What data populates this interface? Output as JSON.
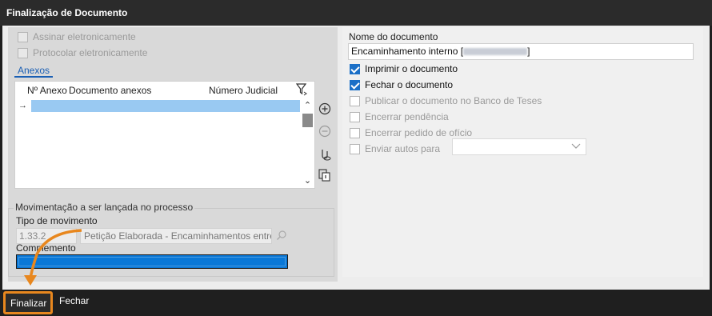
{
  "window": {
    "title": "Finalização de Documento"
  },
  "left": {
    "assinar_label": "Assinar eletronicamente",
    "protocolar_label": "Protocolar eletronicamente",
    "anexos_tab": "Anexos",
    "grid": {
      "col_numero": "Nº Anexo",
      "col_documento": "Documento anexos",
      "col_judicial": "Número Judicial",
      "row_marker": "→"
    },
    "movimentacao": {
      "legend": "Movimentação a ser lançada no processo",
      "tipo_label": "Tipo de movimento",
      "tipo_code": "1.33.2",
      "tipo_desc": "Petição Elaborada - Encaminhamentos entre c",
      "complemento_label": "Complemento",
      "complemento_value": ""
    },
    "icons": [
      "add-circle-icon",
      "remove-circle-icon",
      "attach-icon",
      "copy-attachment-icon",
      "filter-icon"
    ]
  },
  "right": {
    "nome_label": "Nome do documento",
    "nome_value": "Encaminhamento interno [",
    "nome_suffix": "]",
    "options": [
      {
        "label": "Imprimir o documento",
        "checked": true,
        "enabled": true
      },
      {
        "label": "Fechar o documento",
        "checked": true,
        "enabled": true
      },
      {
        "label": "Publicar o documento no Banco de Teses",
        "checked": false,
        "enabled": false
      },
      {
        "label": "Encerrar pendência",
        "checked": false,
        "enabled": false
      },
      {
        "label": "Encerrar pedido de ofício",
        "checked": false,
        "enabled": false
      },
      {
        "label": "Enviar autos para",
        "checked": false,
        "enabled": false
      }
    ],
    "enviar_select_value": ""
  },
  "footer": {
    "finalizar_label": "Finalizar",
    "fechar_label": "Fechar"
  },
  "colors": {
    "accent": "#1a6fc7",
    "highlight": "#e8871e",
    "selection": "#99c9f2"
  }
}
